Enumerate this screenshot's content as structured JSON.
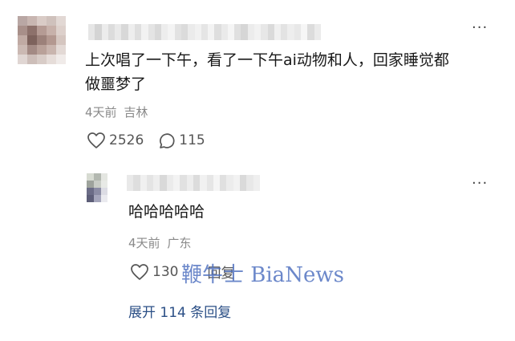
{
  "comment": {
    "text": "上次唱了一下午，看了一下午ai动物和人，回家睡觉都做噩梦了",
    "time": "4天前",
    "location": "吉林",
    "likes": "2526",
    "replies": "115",
    "more_icon": "more-horizontal-icon",
    "avatar_pixels": [
      "#b9a7a4",
      "#c8b6b1",
      "#d9cbc6",
      "#cfc1bc",
      "#e2d8d4",
      "#a88f89",
      "#8d716b",
      "#b59b94",
      "#c7b1aa",
      "#ddd0cb",
      "#c0aaa3",
      "#7d625c",
      "#9c817a",
      "#b39890",
      "#d5c6c0",
      "#cbb9b3",
      "#a38a84",
      "#b9a199",
      "#c9b5ae",
      "#e3d9d5",
      "#e0d6d3",
      "#cdbeb9",
      "#d8ccc7",
      "#e6ddd9",
      "#f0ebe9"
    ],
    "name_pixels": [
      "#e6e6e6",
      "#d4d4d4",
      "#ececec",
      "#dcdcdc",
      "#e9e9e9",
      "#d8d8d8",
      "#eeeeee",
      "#dfdfdf",
      "#f2f2f2",
      "#e4e4e4",
      "#d9d9d9",
      "#ededed",
      "#f4f4f4",
      "#e2e2e2",
      "#dbdbdb",
      "#ebebeb",
      "#f1f1f1",
      "#e5e5e5",
      "#f3f3f3",
      "#dedede",
      "#eaeaea",
      "#f5f5f5",
      "#e0e0e0",
      "#d6d6d6",
      "#ececec",
      "#f2f2f2",
      "#e7e7e7",
      "#dadada",
      "#f0f0f0",
      "#e3e3e3",
      "#eeeeee",
      "#e8e8e8",
      "#f6f6f6",
      "#dcdcdc",
      "#ebebeb"
    ]
  },
  "reply": {
    "text": "哈哈哈哈哈",
    "time": "4天前",
    "location": "广东",
    "likes": "130",
    "reply_label": "回复",
    "more_icon": "more-horizontal-icon",
    "avatar_pixels": [
      "#d7dbd2",
      "#b3b8b0",
      "#e4e6e1",
      "#9ea39c",
      "#c9cdc6",
      "#e8eae6",
      "#6b6c86",
      "#8b8ca4",
      "#dcdce4",
      "#5d5e78",
      "#a5a6bb",
      "#eaeaef"
    ],
    "name_pixels": [
      "#e9e9e9",
      "#dedede",
      "#f0f0f0",
      "#e4e4e4",
      "#eeeeee",
      "#d9d9d9",
      "#ebebeb",
      "#f3f3f3",
      "#e1e1e1",
      "#ededed",
      "#dcdcdc",
      "#f1f1f1",
      "#e6e6e6",
      "#f5f5f5",
      "#e0e0e0",
      "#ececec",
      "#f2f2f2",
      "#dadada",
      "#e8e8e8",
      "#efefef"
    ]
  },
  "expand": {
    "label": "展开 114 条回复"
  },
  "watermark": {
    "text": "鞭牛士 BiaNews"
  },
  "colors": {
    "link": "#2b4f86",
    "meta": "#8a8a8a",
    "watermark": "#4c6ebe"
  }
}
